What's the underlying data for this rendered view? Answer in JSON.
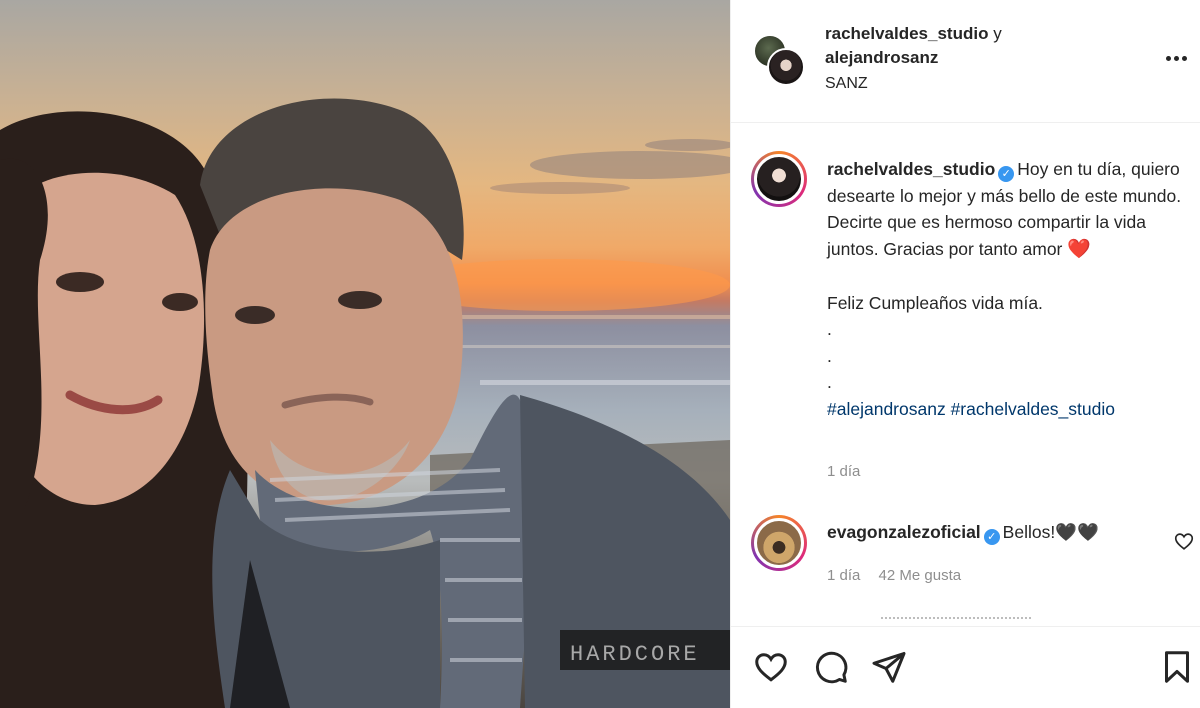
{
  "post": {
    "photo": {
      "alt_icon": "couple-sunset-selfie-photo",
      "jacket_patch_text": "HARDCORE"
    },
    "header": {
      "user1": "rachelvaldes_studio",
      "connector": "y",
      "user2": "alejandrosanz",
      "location": "SANZ"
    },
    "caption": {
      "username": "rachelvaldes_studio",
      "verified": true,
      "line1": "Hoy en tu día, quiero desearte lo mejor y más bello de este mundo. Decirte que es hermoso compartir la vida juntos. Gracias por tanto amor",
      "heart": "❤️",
      "line2": "Feliz Cumpleaños vida mía.",
      "dot": ".",
      "hashtag1": "#alejandrosanz",
      "hashtag2": "#rachelvaldes_studio",
      "time": "1 día"
    },
    "comment": {
      "username": "evagonzalezoficial",
      "verified": true,
      "text": "Bellos!🖤🖤",
      "time": "1 día",
      "likes": "42 Me gusta"
    },
    "colors": {
      "text": "#262626",
      "muted": "#8e8e8e",
      "hashtag": "#00376b",
      "verified": "#3897f0",
      "heart": "#e0243a"
    },
    "icons": [
      "more-options-icon",
      "heart-icon",
      "comment-icon",
      "share-icon",
      "bookmark-icon",
      "verified-badge-icon"
    ]
  }
}
